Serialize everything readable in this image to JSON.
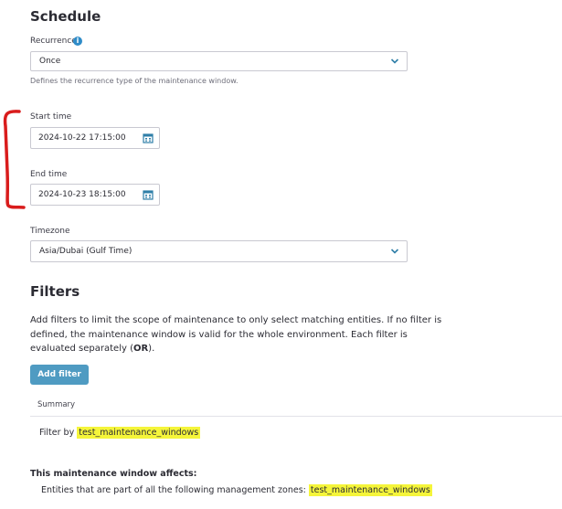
{
  "schedule": {
    "title": "Schedule",
    "recurrence": {
      "label": "Recurrence",
      "value": "Once",
      "hint": "Defines the recurrence type of the maintenance window."
    },
    "start_time": {
      "label": "Start time",
      "value": "2024-10-22 17:15:00"
    },
    "end_time": {
      "label": "End time",
      "value": "2024-10-23 18:15:00"
    },
    "timezone": {
      "label": "Timezone",
      "value": "Asia/Dubai (Gulf Time)"
    }
  },
  "filters": {
    "title": "Filters",
    "description_line1": "Add filters to limit the scope of maintenance to only select matching entities. If no filter is",
    "description_line2": "defined, the maintenance window is valid for the whole environment. Each filter is",
    "description_line3_prefix": "evaluated separately (",
    "description_line3_bold": "OR",
    "description_line3_suffix": ").",
    "add_button": "Add filter",
    "table_header": "Summary",
    "row_prefix": "Filter by ",
    "row_value": "test_maintenance_windows"
  },
  "affects": {
    "title": "This maintenance window affects:",
    "text_prefix": "Entities that are part of all the following management zones: ",
    "zone": "test_maintenance_windows"
  },
  "colors": {
    "accent": "#4f9bc2",
    "info_icon": "#2f8cc8",
    "highlight": "#f5f53a",
    "annotation_bracket": "#d91c1c"
  }
}
